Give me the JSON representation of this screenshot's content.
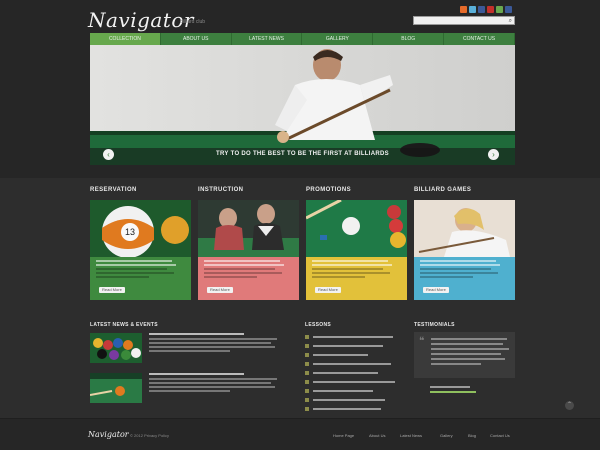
{
  "header": {
    "logo": "Navigator",
    "tagline": "billiard club",
    "social_icons": [
      "rss-icon",
      "twitter-icon",
      "facebook-icon",
      "youtube-icon",
      "linkedin-icon",
      "facebook-icon"
    ],
    "social_colors": [
      "#e66b2a",
      "#5ab0d9",
      "#3b5998",
      "#c4302b",
      "#6aa84f",
      "#3b5998"
    ],
    "search_placeholder": ""
  },
  "nav": {
    "items": [
      "Collection",
      "About Us",
      "Latest News",
      "Gallery",
      "Blog",
      "Contact Us"
    ],
    "active_index": 0
  },
  "hero": {
    "caption": "TRY TO DO THE BEST TO BE THE FIRST AT BILLIARDS",
    "prev_label": "‹",
    "next_label": "›"
  },
  "columns": {
    "titles": [
      "RESERVATION",
      "INSTRUCTION",
      "PROMOTIONS",
      "BILLIARD GAMES"
    ],
    "button_label": "Read More",
    "colors": [
      "#3f8a3f",
      "#e07a7a",
      "#e2c13a",
      "#4fb0cf"
    ]
  },
  "news": {
    "title": "Latest News & Events"
  },
  "lessons": {
    "title": "Lessons"
  },
  "testimonials": {
    "title": "Testimonials"
  },
  "footer": {
    "logo": "Navigator",
    "copyright": "© 2012 Privacy Policy",
    "links": [
      "Home Page",
      "About Us",
      "Latest News",
      "Gallery",
      "Blog",
      "Contact Us"
    ]
  },
  "accent_color": "#3d7f3f"
}
